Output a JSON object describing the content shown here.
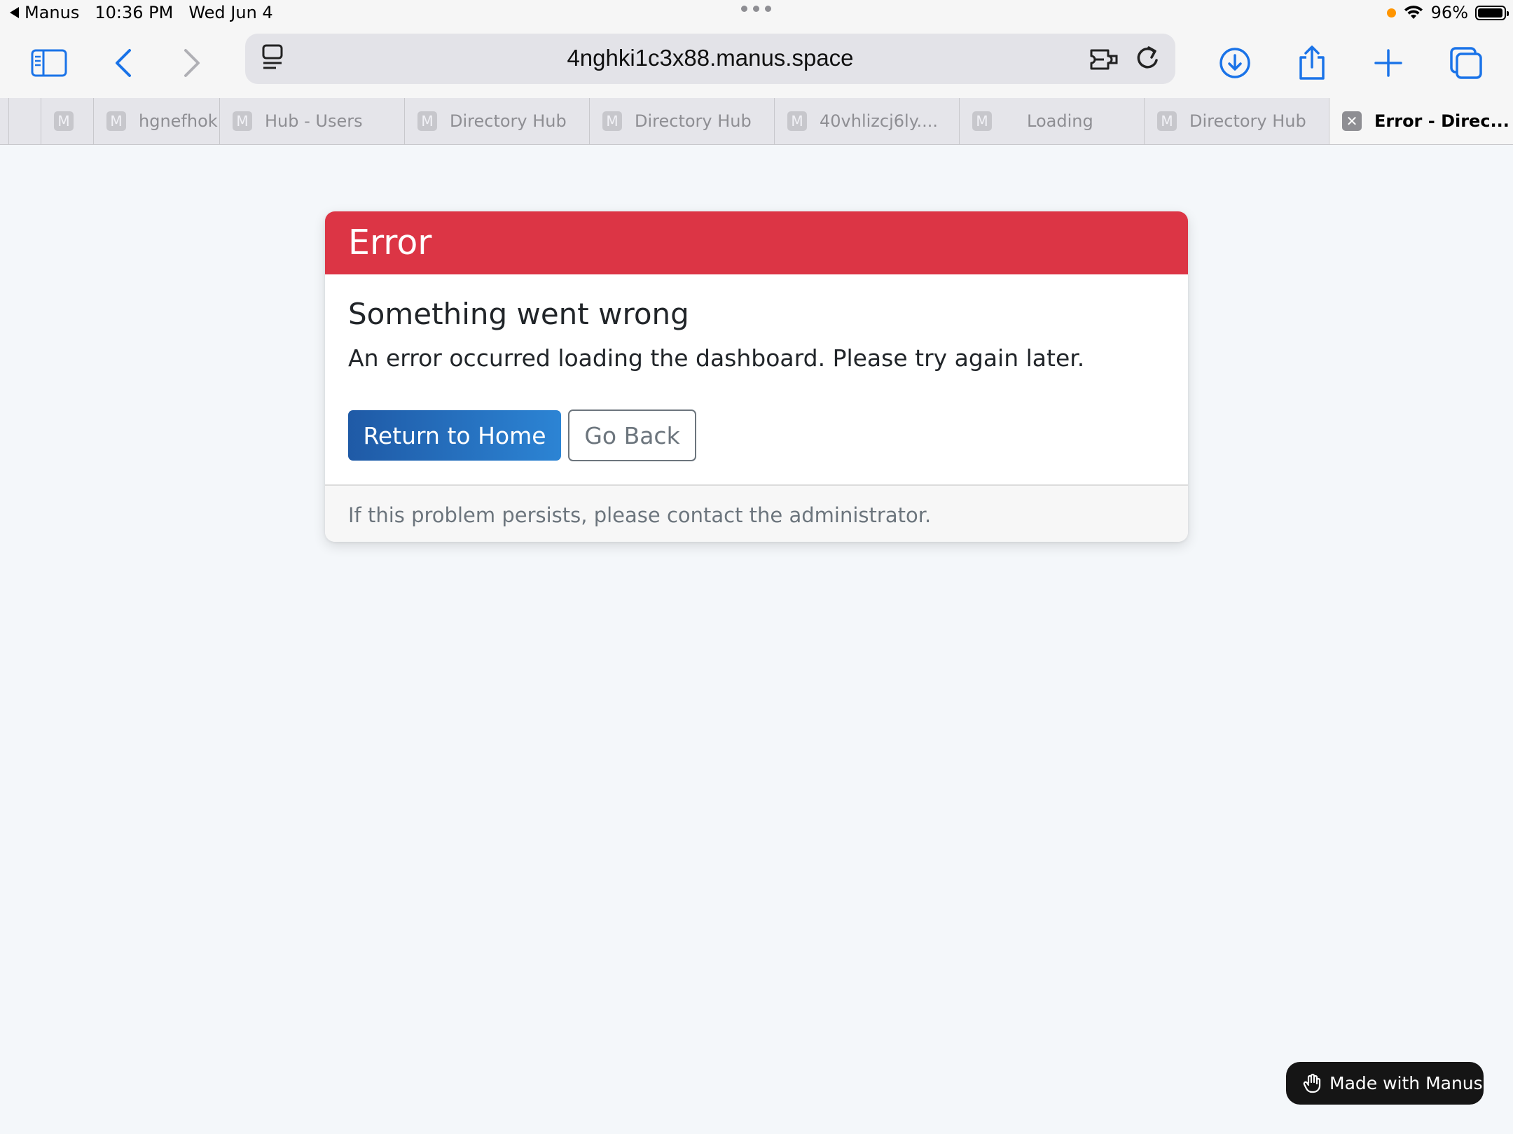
{
  "status_bar": {
    "back_app": "Manus",
    "time": "10:36 PM",
    "date": "Wed Jun 4",
    "battery": "96%"
  },
  "browser": {
    "url": "4nghki1c3x88.manus.space",
    "tabs": [
      {
        "label": "",
        "favicon": ""
      },
      {
        "label": "",
        "favicon": "M"
      },
      {
        "label": "hgnefhok",
        "favicon": "M"
      },
      {
        "label": "Hub - Users",
        "favicon": "M"
      },
      {
        "label": "Directory Hub",
        "favicon": "M"
      },
      {
        "label": "Directory Hub",
        "favicon": "M"
      },
      {
        "label": "40vhlizcj6ly....",
        "favicon": "M"
      },
      {
        "label": "Loading",
        "favicon": "M"
      },
      {
        "label": "Directory Hub",
        "favicon": "M"
      },
      {
        "label": "Error - Direc...",
        "favicon": "✕",
        "active": true
      }
    ]
  },
  "error_card": {
    "header": "Error",
    "title": "Something went wrong",
    "message": "An error occurred loading the dashboard. Please try again later.",
    "primary_button": "Return to Home",
    "secondary_button": "Go Back",
    "footer": "If this problem persists, please contact the administrator."
  },
  "badge": {
    "label": "Made with Manus"
  },
  "colors": {
    "header_bg": "#dc3545",
    "primary_btn": "#2c84d4",
    "page_bg": "#f4f7fa",
    "accent": "#1a73e8"
  }
}
